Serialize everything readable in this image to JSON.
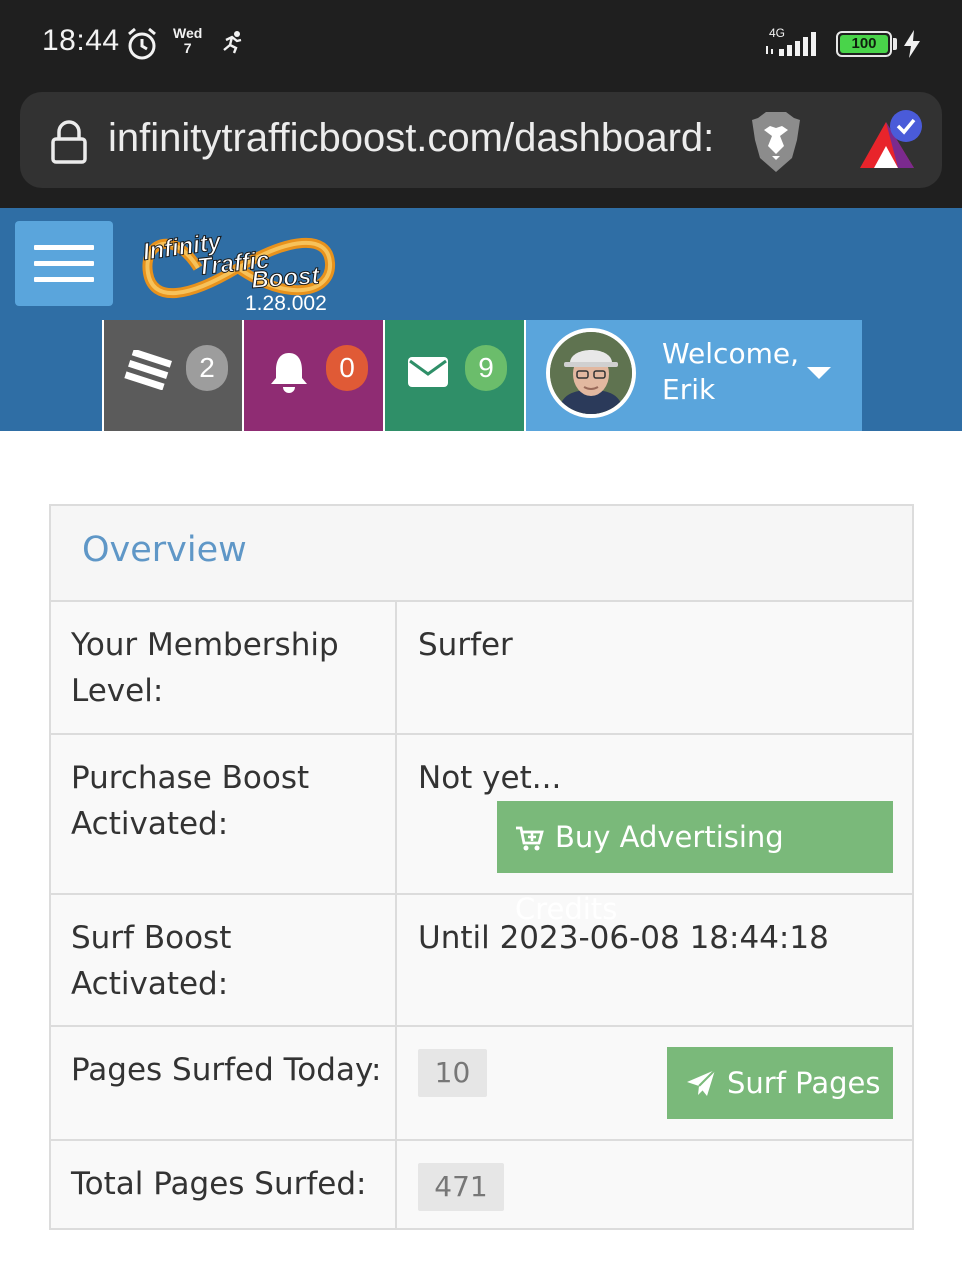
{
  "status_bar": {
    "time": "18:44",
    "day_name": "Wed",
    "day_num": "7",
    "network": "4G",
    "battery": "100",
    "icons": [
      "alarm-icon",
      "running-icon",
      "signal-icon",
      "battery-icon",
      "charging-icon"
    ]
  },
  "browser": {
    "url": "infinitytrafficboost.com/dashboard:",
    "icons": [
      "lock-icon",
      "brave-lion-icon",
      "brave-rewards-icon"
    ]
  },
  "header": {
    "logo_line1": "Infinity",
    "logo_line2": "Traffic",
    "logo_line3": "Boost",
    "version": "1.28.002",
    "brand_color": "#2f6ea5"
  },
  "nav": {
    "tasks_count": "2",
    "notifications_count": "0",
    "messages_count": "9",
    "welcome_label": "Welcome,",
    "user_name": "Erik",
    "colors": {
      "tasks": "#5b5b5b",
      "notifications": "#8f2c73",
      "messages": "#2f8f68",
      "user": "#5aa5dc"
    }
  },
  "overview": {
    "title": "Overview",
    "rows": [
      {
        "label": "Your Membership Level:",
        "value": "Surfer"
      },
      {
        "label": "Purchase Boost Activated:",
        "value": "Not yet...",
        "button": "Buy Advertising Credits"
      },
      {
        "label": "Surf Boost Activated:",
        "value": "Until 2023-06-08 18:44:18"
      },
      {
        "label": "Pages Surfed Today:",
        "value": "10",
        "button": "Surf Pages"
      },
      {
        "label": "Total Pages Surfed:",
        "value": "471"
      }
    ],
    "button_color": "#7ab97a"
  }
}
